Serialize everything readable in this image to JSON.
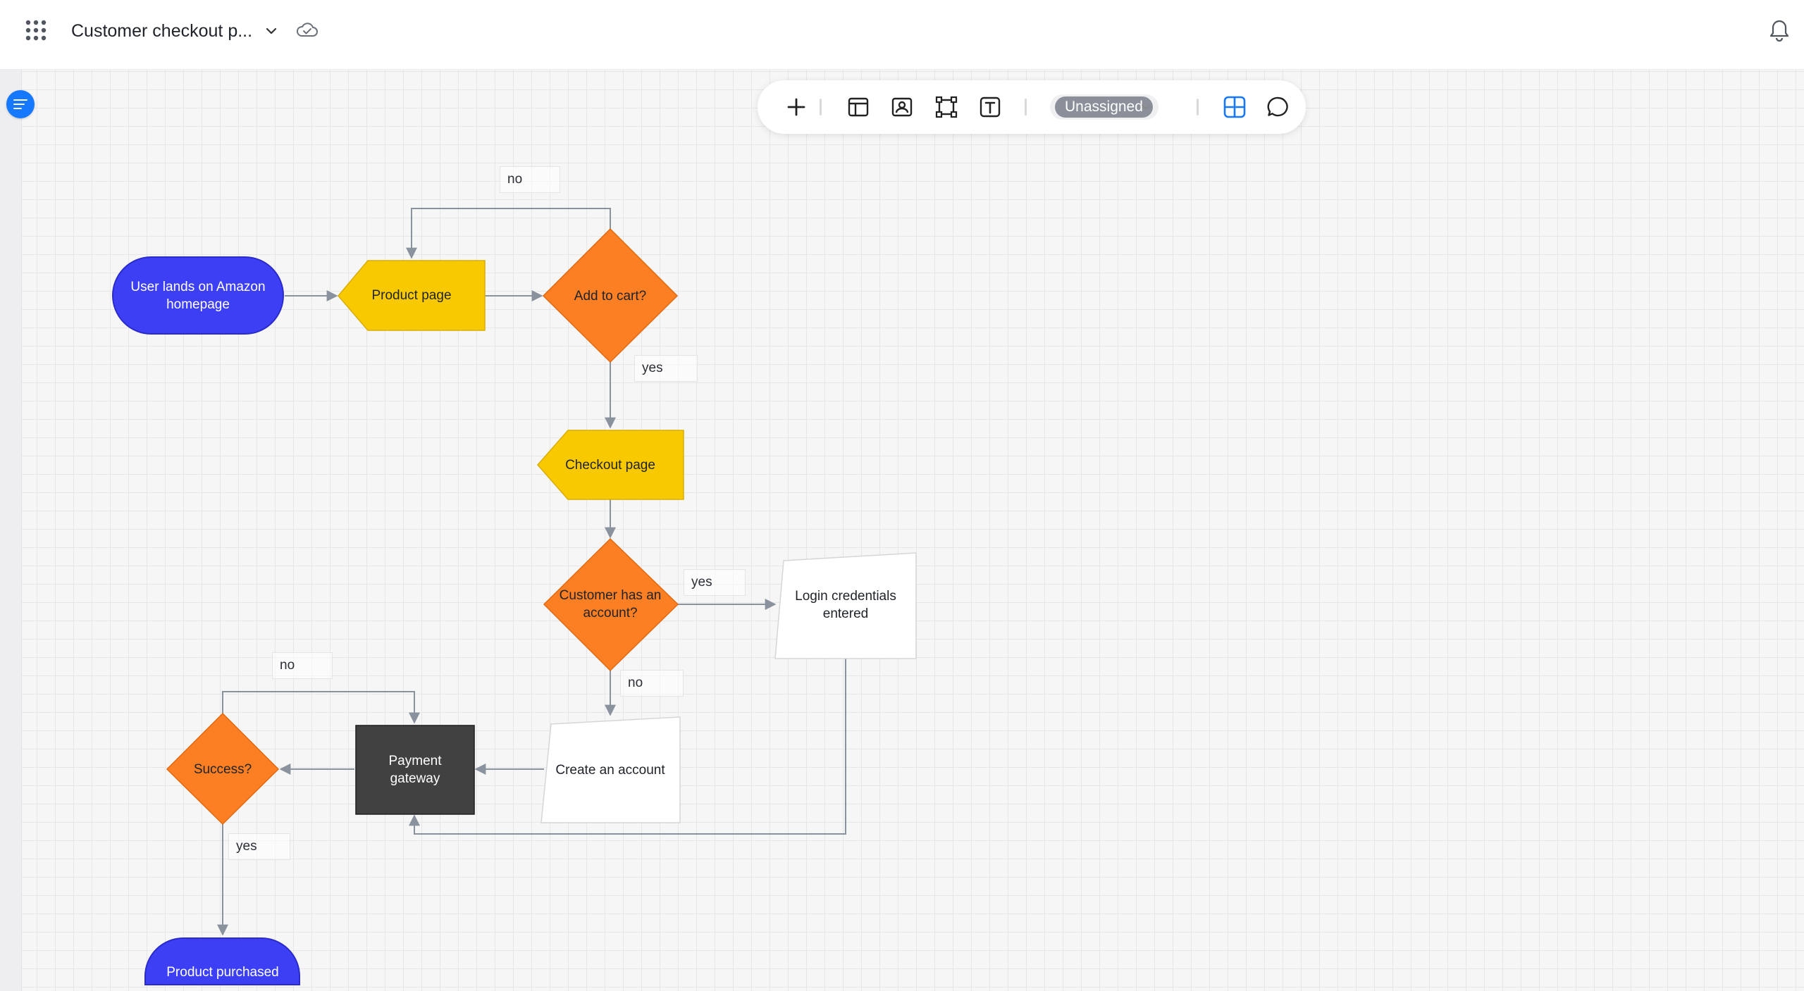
{
  "header": {
    "title": "Customer checkout p...",
    "icons": [
      "apps-grid-icon",
      "chevron-down-icon",
      "cloud-sync-icon",
      "bell-icon"
    ]
  },
  "toolbar": {
    "tools": [
      "plus-icon",
      "template-icon",
      "image-icon",
      "frame-icon",
      "text-icon",
      "grid-view-icon",
      "comment-icon"
    ],
    "assignee": "Unassigned"
  },
  "diagram": {
    "nodes": {
      "start": "User lands on Amazon homepage",
      "product_page": "Product page",
      "add_to_cart": "Add to cart?",
      "checkout_page": "Checkout page",
      "has_account": "Customer has an account?",
      "login": "Login credentials entered",
      "create_account": "Create an account",
      "payment": "Payment gateway",
      "success": "Success?",
      "end": "Product purchased"
    },
    "edge_labels": {
      "cart_no": "no",
      "cart_yes": "yes",
      "account_yes": "yes",
      "account_no": "no",
      "success_no": "no",
      "success_yes": "yes"
    },
    "colors": {
      "terminal": "#3d3ff5",
      "page": "#f9c900",
      "decision": "#fc7f24",
      "process_dark": "#414141",
      "connector": "#8a929e"
    }
  }
}
